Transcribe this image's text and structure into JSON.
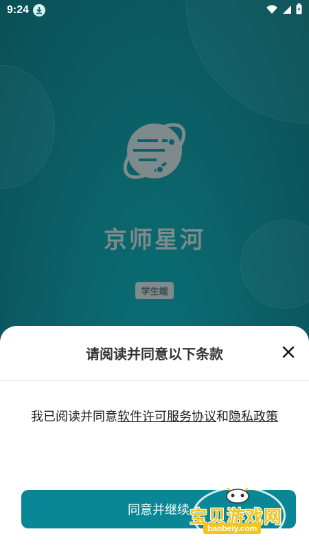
{
  "status_bar": {
    "time": "9:24",
    "icons": [
      "download-icon",
      "wifi-icon",
      "signal-icon",
      "battery-charging-icon"
    ]
  },
  "splash": {
    "app_name": "京师星河",
    "badge": "学生端",
    "logo_icon": "planet-logo-icon"
  },
  "dialog": {
    "title": "请阅读并同意以下条款",
    "body_prefix": "我已阅读并同意",
    "link_license": "软件许可服务协议",
    "conjunction": "和",
    "link_privacy": "隐私政策",
    "agree_button": "同意并继续"
  },
  "watermark": {
    "text": "宝贝游戏网",
    "url": "baobeiy.com"
  },
  "colors": {
    "background": "#0b6168",
    "accent": "#0a8796",
    "logo_gray": "#7e8a8b"
  }
}
